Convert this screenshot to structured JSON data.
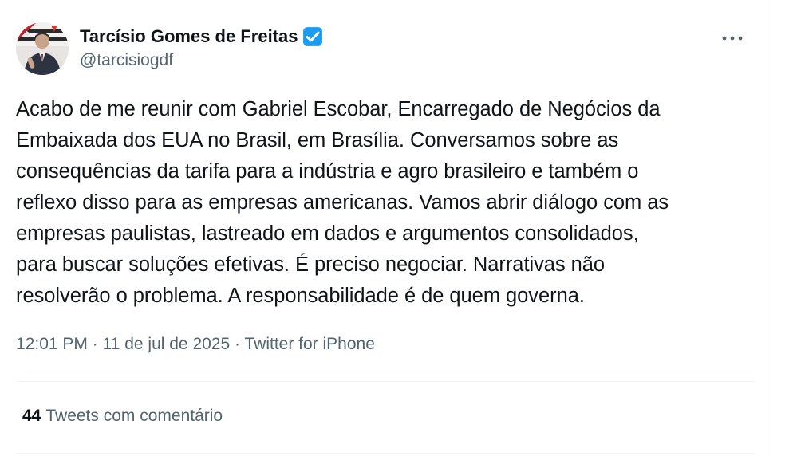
{
  "author": {
    "display_name": "Tarcísio Gomes de Freitas",
    "handle": "@tarcisiogdf",
    "verified_icon": "verified-badge-icon",
    "verified_color": "#1d9bf0"
  },
  "tweet": {
    "text": "Acabo de me reunir com Gabriel Escobar, Encarregado de Negócios da\nEmbaixada dos EUA no Brasil, em Brasília. Conversamos sobre as\nconsequências da tarifa para a indústria e agro brasileiro e também o\nreflexo disso para as empresas americanas. Vamos abrir diálogo com as\nempresas paulistas, lastreado em dados e argumentos consolidados,\npara buscar soluções efetivas. É preciso negociar. Narrativas não\nresolverão o problema. A responsabilidade é de quem governa.",
    "time": "12:01 PM",
    "separator": "·",
    "date": "11 de jul de 2025",
    "source": "Twitter for iPhone"
  },
  "quotes": {
    "count": "44",
    "label": "Tweets com comentário"
  },
  "colors": {
    "text": "#0f1419",
    "secondary": "#536471",
    "divider": "#eff3f4"
  }
}
